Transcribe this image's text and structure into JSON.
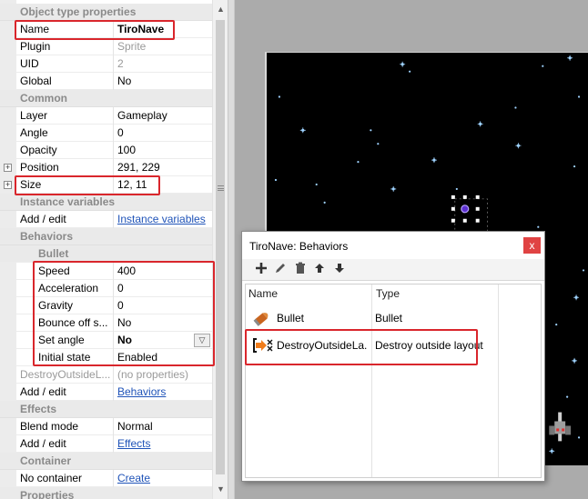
{
  "properties": {
    "rows": [
      {
        "kind": "cat",
        "label": "Object type properties",
        "value": ""
      },
      {
        "kind": "prop",
        "label": "Name",
        "value": "TiroNave",
        "bold": true
      },
      {
        "kind": "prop",
        "label": "Plugin",
        "value": "Sprite",
        "grey": true
      },
      {
        "kind": "prop",
        "label": "UID",
        "value": "2",
        "grey": true
      },
      {
        "kind": "prop",
        "label": "Global",
        "value": "No"
      },
      {
        "kind": "cat",
        "label": "Common",
        "value": ""
      },
      {
        "kind": "prop",
        "label": "Layer",
        "value": "Gameplay"
      },
      {
        "kind": "prop",
        "label": "Angle",
        "value": "0"
      },
      {
        "kind": "prop",
        "label": "Opacity",
        "value": "100"
      },
      {
        "kind": "prop",
        "label": "Position",
        "value": "291, 229",
        "expander": true
      },
      {
        "kind": "prop",
        "label": "Size",
        "value": "12, 11",
        "expander": true
      },
      {
        "kind": "cat",
        "label": "Instance variables",
        "value": ""
      },
      {
        "kind": "prop",
        "label": "Add / edit",
        "value": "Instance variables",
        "link": true
      },
      {
        "kind": "cat",
        "label": "Behaviors",
        "value": ""
      },
      {
        "kind": "subcat",
        "label": "Bullet",
        "value": ""
      },
      {
        "kind": "prop",
        "label": "Speed",
        "value": "400",
        "indent": true
      },
      {
        "kind": "prop",
        "label": "Acceleration",
        "value": "0",
        "indent": true
      },
      {
        "kind": "prop",
        "label": "Gravity",
        "value": "0",
        "indent": true
      },
      {
        "kind": "prop",
        "label": "Bounce off s...",
        "value": "No",
        "indent": true
      },
      {
        "kind": "prop",
        "label": "Set angle",
        "value": "No",
        "indent": true,
        "bold": true,
        "dropdown": true
      },
      {
        "kind": "prop",
        "label": "Initial state",
        "value": "Enabled",
        "indent": true
      },
      {
        "kind": "prop",
        "label": "DestroyOutsideL...",
        "value": "(no properties)",
        "grey": true,
        "greyLabel": true
      },
      {
        "kind": "prop",
        "label": "Add / edit",
        "value": "Behaviors",
        "link": true
      },
      {
        "kind": "cat",
        "label": "Effects",
        "value": ""
      },
      {
        "kind": "prop",
        "label": "Blend mode",
        "value": "Normal"
      },
      {
        "kind": "prop",
        "label": "Add / edit",
        "value": "Effects",
        "link": true
      },
      {
        "kind": "cat",
        "label": "Container",
        "value": ""
      },
      {
        "kind": "prop",
        "label": "No container",
        "value": "Create",
        "link": true
      },
      {
        "kind": "cat",
        "label": "Properties",
        "value": ""
      }
    ]
  },
  "dialog": {
    "title": "TiroNave: Behaviors",
    "close_label": "x",
    "toolbar": {
      "add_icon": "plus-icon",
      "edit_icon": "pencil-icon",
      "delete_icon": "trash-icon",
      "move_up_icon": "arrow-up-icon",
      "move_down_icon": "arrow-down-icon"
    },
    "columns": {
      "name": "Name",
      "type": "Type"
    },
    "behaviors": [
      {
        "name": "Bullet",
        "type": "Bullet",
        "icon": "bullet-icon"
      },
      {
        "name": "DestroyOutsideLa...",
        "type": "Destroy outside layout",
        "icon": "destroy-outside-icon"
      }
    ]
  },
  "colors": {
    "highlight": "#d9262c",
    "category_bg": "#eaeaea",
    "link": "#1f53b8",
    "canvas": "#000000",
    "star": "#9fd3ff",
    "close_button": "#e04343"
  }
}
